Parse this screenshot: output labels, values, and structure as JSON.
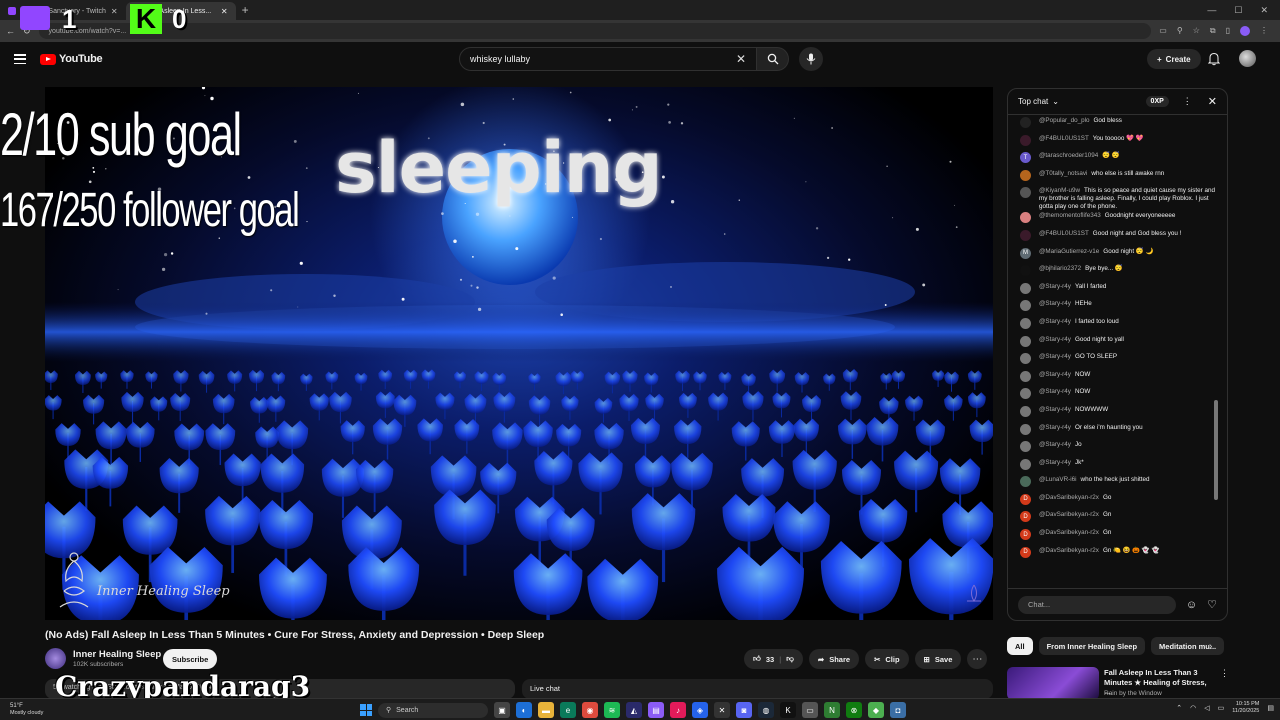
{
  "browser": {
    "tabs": [
      {
        "label": "Aiveyc's Sanctuary - Twitch"
      },
      {
        "label": "Fall Asleep In Less..."
      }
    ],
    "new_tab": "+",
    "url": "youtube.com/watch?v=..."
  },
  "header": {
    "logo": "YouTube",
    "search_value": "whiskey lullaby",
    "create_label": "Create"
  },
  "video": {
    "overlay_title": "sleeping",
    "watermark": "Inner Healing Sleep",
    "title": "(No Ads) Fall Asleep In Less Than 5 Minutes • Cure For Stress, Anxiety and Depression • Deep Sleep",
    "channel": "Inner Healing Sleep",
    "subscribers": "102K subscribers",
    "subscribe_label": "Subscribe",
    "likes": "33",
    "share_label": "Share",
    "clip_label": "Clip",
    "save_label": "Save",
    "description_snippet": "52 watching now  Started streaming on Mar 5, 2024",
    "live_chat_label": "Live chat"
  },
  "stream_overlay": {
    "twitch_count": "1",
    "kick_count": "0",
    "sub_goal": "2/10 sub goal",
    "follower_goal": "167/250 follower goal",
    "streamer_name": "Crazypandarag3"
  },
  "chat": {
    "mode_label": "Top chat",
    "xp_badge": "0XP",
    "input_placeholder": "Chat...",
    "messages": [
      {
        "user": "@Popular_do_plo",
        "text": "God bless",
        "color": "#222"
      },
      {
        "user": "@F4BUL0US1ST",
        "text": "You tooooo 💖 💖",
        "color": "#3a1a2a"
      },
      {
        "user": "@taraschroeder1094",
        "text": "😴 😴",
        "color": "#6a5acd"
      },
      {
        "user": "@T0tally_notsavi",
        "text": "who else is still awake rnn",
        "color": "#b5651d"
      },
      {
        "user": "@KiyanM-u9w",
        "text": "This is so peace and quiet cause my sister and my brother is falling asleep. Finally, I could play Roblox. I just gotta play one of the phone.",
        "color": "#555"
      },
      {
        "user": "@themomentoflife343",
        "text": "Goodnight everyoneeeee",
        "color": "#d98080"
      },
      {
        "user": "@F4BUL0US1ST",
        "text": "Good night and God bless you !",
        "color": "#3a1a2a"
      },
      {
        "user": "@MariaGutierrez-v1e",
        "text": "Good night 😴 🌙",
        "color": "#5f6b73"
      },
      {
        "user": "@bjhilario2372",
        "text": "Bye bye... 😴",
        "color": "#111"
      },
      {
        "user": "@Stary-r4y",
        "text": "Yall I farted",
        "color": "#777"
      },
      {
        "user": "@Stary-r4y",
        "text": "HEHe",
        "color": "#777"
      },
      {
        "user": "@Stary-r4y",
        "text": "I farted too loud",
        "color": "#777"
      },
      {
        "user": "@Stary-r4y",
        "text": "Good night to yall",
        "color": "#777"
      },
      {
        "user": "@Stary-r4y",
        "text": "GO TO SLEEP",
        "color": "#777"
      },
      {
        "user": "@Stary-r4y",
        "text": "NOW",
        "color": "#777"
      },
      {
        "user": "@Stary-r4y",
        "text": "NOW",
        "color": "#777"
      },
      {
        "user": "@Stary-r4y",
        "text": "NOWWWW",
        "color": "#777"
      },
      {
        "user": "@Stary-r4y",
        "text": "Or else i'm haunting you",
        "color": "#777"
      },
      {
        "user": "@Stary-r4y",
        "text": "Jo",
        "color": "#777"
      },
      {
        "user": "@Stary-r4y",
        "text": "Jk*",
        "color": "#777"
      },
      {
        "user": "@LunaVR-i6i",
        "text": "who the heck just shitted",
        "color": "#4a6a5a"
      },
      {
        "user": "@DavSaribekyan-r2x",
        "text": "Go",
        "color": "#d33a1a"
      },
      {
        "user": "@DavSaribekyan-r2x",
        "text": "Gn",
        "color": "#d33a1a"
      },
      {
        "user": "@DavSaribekyan-r2x",
        "text": "Gn",
        "color": "#d33a1a"
      },
      {
        "user": "@DavSaribekyan-r2x",
        "text": "Gn 🍋 😆 🎃 👻 👻",
        "color": "#d33a1a"
      }
    ],
    "avatar_letters": {
      "taraschroeder1094": "T",
      "MariaGutierrez-v1e": "M",
      "DavSaribekyan-r2x": "D"
    }
  },
  "recommendations": {
    "chips": [
      "All",
      "From Inner Healing Sleep",
      "Meditation mu..."
    ],
    "item": {
      "title": "Fall Asleep In Less Than 3 Minutes ★ Healing of Stress, ...",
      "channel": "Rain by the Window"
    }
  },
  "taskbar": {
    "temperature": "51°F",
    "weather": "Mostly cloudy",
    "search_label": "Search",
    "time": "10:15 PM",
    "date": "11/20/2025"
  },
  "colors": {
    "accent_red": "#ff0000",
    "twitch_purple": "#9146ff",
    "kick_green": "#53fc18"
  }
}
